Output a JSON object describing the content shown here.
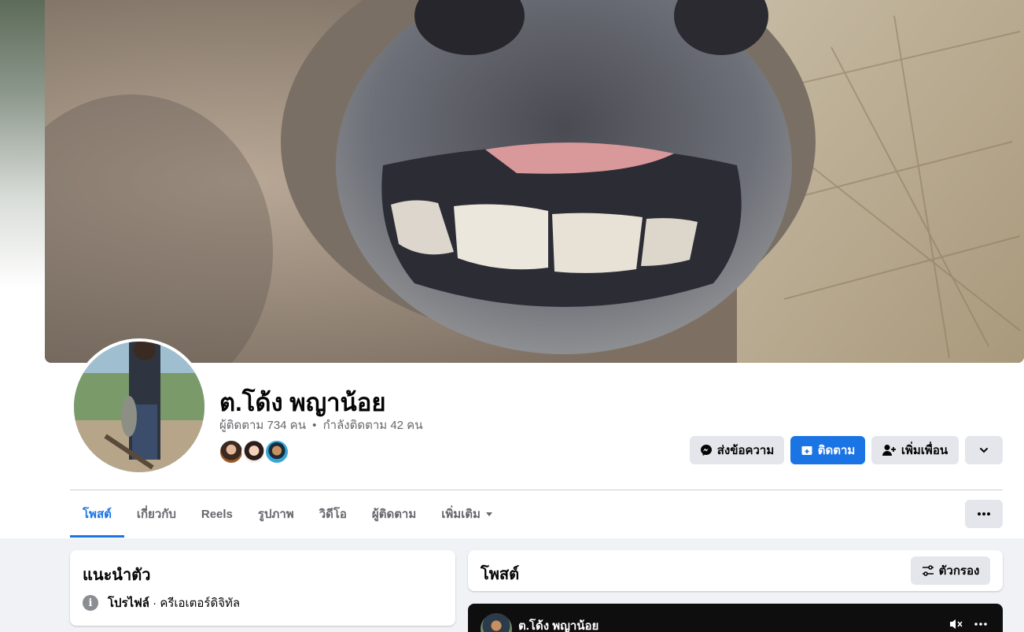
{
  "profile": {
    "name": "ต.โด้ง พญาน้อย",
    "followers": "ผู้ติดตาม 734 คน",
    "separator": "•",
    "following": "กำลังติดตาม 42 คน"
  },
  "actions": {
    "message_label": "ส่งข้อความ",
    "follow_label": "ติดตาม",
    "add_friend_label": "เพิ่มเพื่อน"
  },
  "tabs": [
    {
      "label": "โพสต์",
      "active": true
    },
    {
      "label": "เกี่ยวกับ"
    },
    {
      "label": "Reels"
    },
    {
      "label": "รูปภาพ"
    },
    {
      "label": "วิดีโอ"
    },
    {
      "label": "ผู้ติดตาม"
    },
    {
      "label": "เพิ่มเติม"
    }
  ],
  "intro": {
    "title": "แนะนำตัว",
    "profile_label": "โปรไฟล์",
    "profile_detail": " · ครีเอเตอร์ดิจิทัล",
    "info_icon": "i"
  },
  "posts": {
    "title": "โพสต์",
    "filter_label": "ตัวกรอง"
  },
  "post_preview": {
    "author": "ต.โด้ง พญาน้อย"
  },
  "colors": {
    "accent": "#1b74e4",
    "background": "#f0f2f5",
    "button_gray": "#e4e6eb"
  }
}
